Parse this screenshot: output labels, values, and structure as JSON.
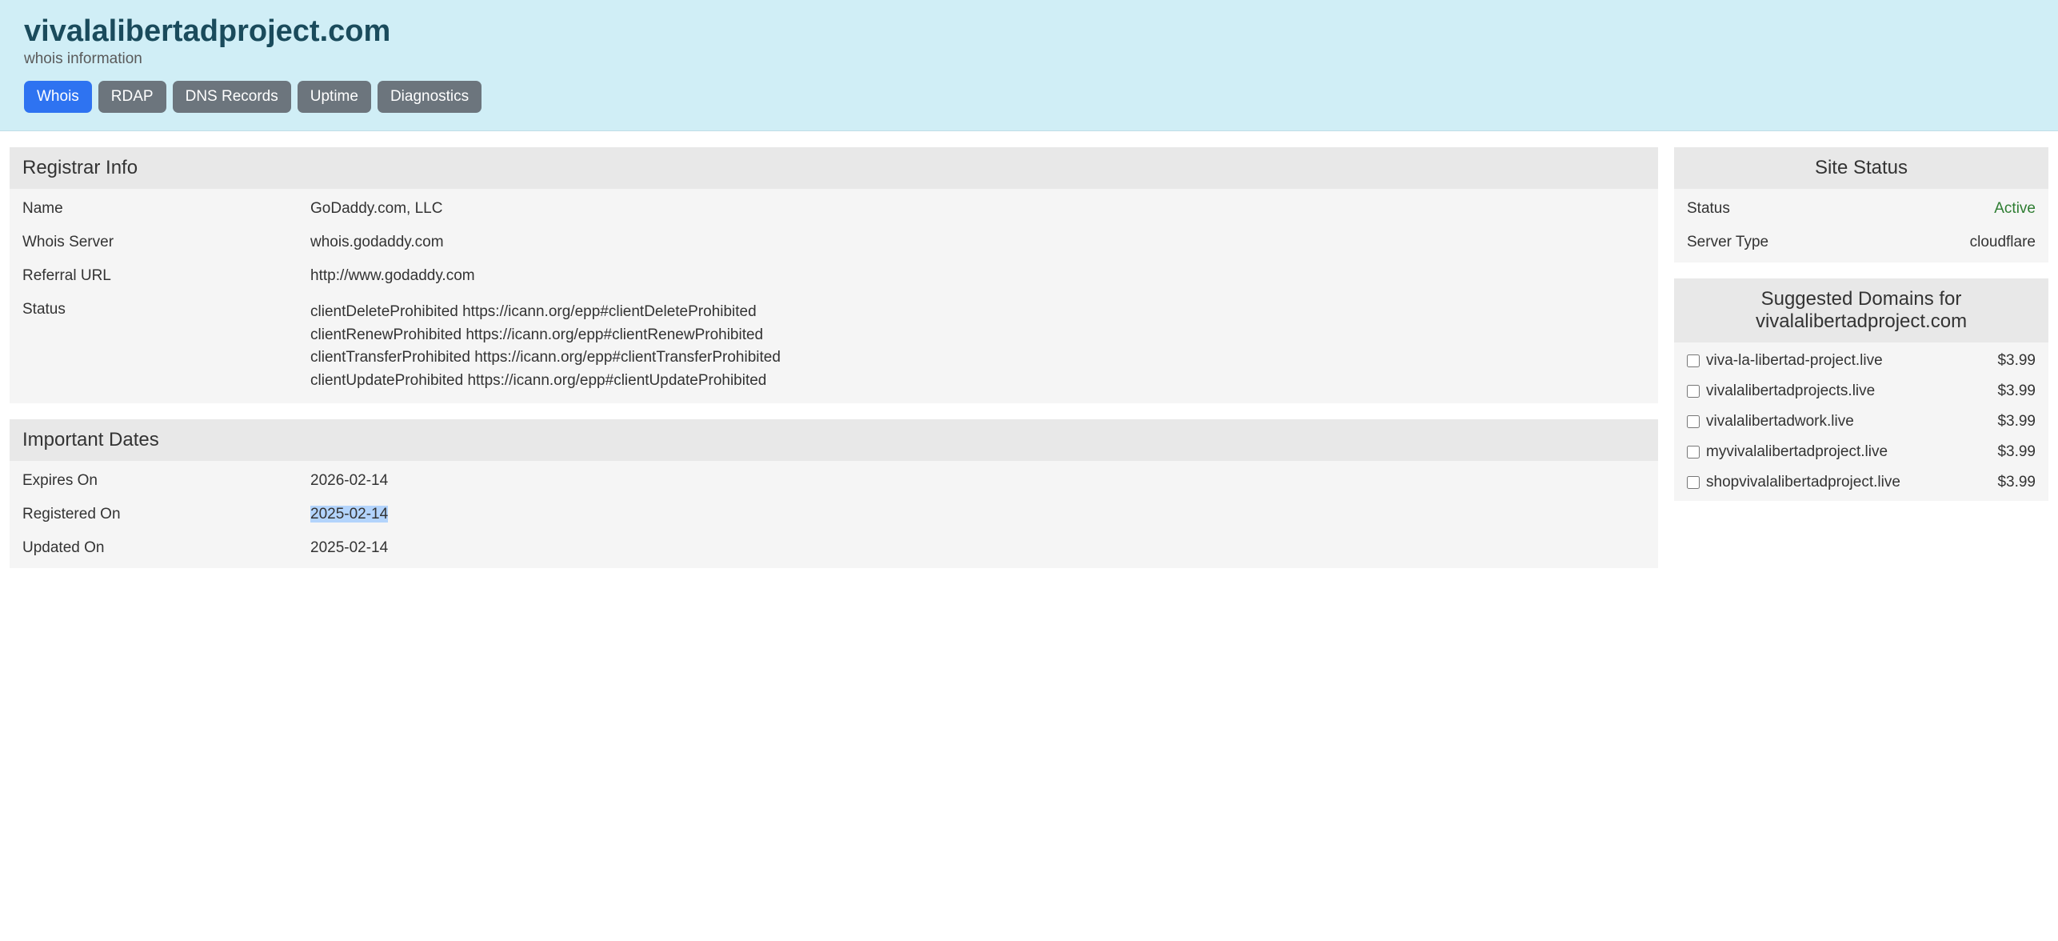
{
  "header": {
    "domain": "vivalalibertadproject.com",
    "subtitle": "whois information",
    "tabs": [
      {
        "label": "Whois",
        "active": true
      },
      {
        "label": "RDAP",
        "active": false
      },
      {
        "label": "DNS Records",
        "active": false
      },
      {
        "label": "Uptime",
        "active": false
      },
      {
        "label": "Diagnostics",
        "active": false
      }
    ]
  },
  "registrar": {
    "title": "Registrar Info",
    "name_label": "Name",
    "name_value": "GoDaddy.com, LLC",
    "whois_label": "Whois Server",
    "whois_value": "whois.godaddy.com",
    "referral_label": "Referral URL",
    "referral_value": "http://www.godaddy.com",
    "status_label": "Status",
    "status_lines": [
      "clientDeleteProhibited https://icann.org/epp#clientDeleteProhibited",
      "clientRenewProhibited https://icann.org/epp#clientRenewProhibited",
      "clientTransferProhibited https://icann.org/epp#clientTransferProhibited",
      "clientUpdateProhibited https://icann.org/epp#clientUpdateProhibited"
    ]
  },
  "dates": {
    "title": "Important Dates",
    "expires_label": "Expires On",
    "expires_value": "2026-02-14",
    "registered_label": "Registered On",
    "registered_value": "2025-02-14",
    "updated_label": "Updated On",
    "updated_value": "2025-02-14"
  },
  "site_status": {
    "title": "Site Status",
    "status_label": "Status",
    "status_value": "Active",
    "server_label": "Server Type",
    "server_value": "cloudflare"
  },
  "suggested": {
    "title": "Suggested Domains for vivalalibertadproject.com",
    "items": [
      {
        "name": "viva-la-libertad-project.live",
        "price": "$3.99"
      },
      {
        "name": "vivalalibertadprojects.live",
        "price": "$3.99"
      },
      {
        "name": "vivalalibertadwork.live",
        "price": "$3.99"
      },
      {
        "name": "myvivalalibertadproject.live",
        "price": "$3.99"
      },
      {
        "name": "shopvivalalibertadproject.live",
        "price": "$3.99"
      }
    ]
  }
}
